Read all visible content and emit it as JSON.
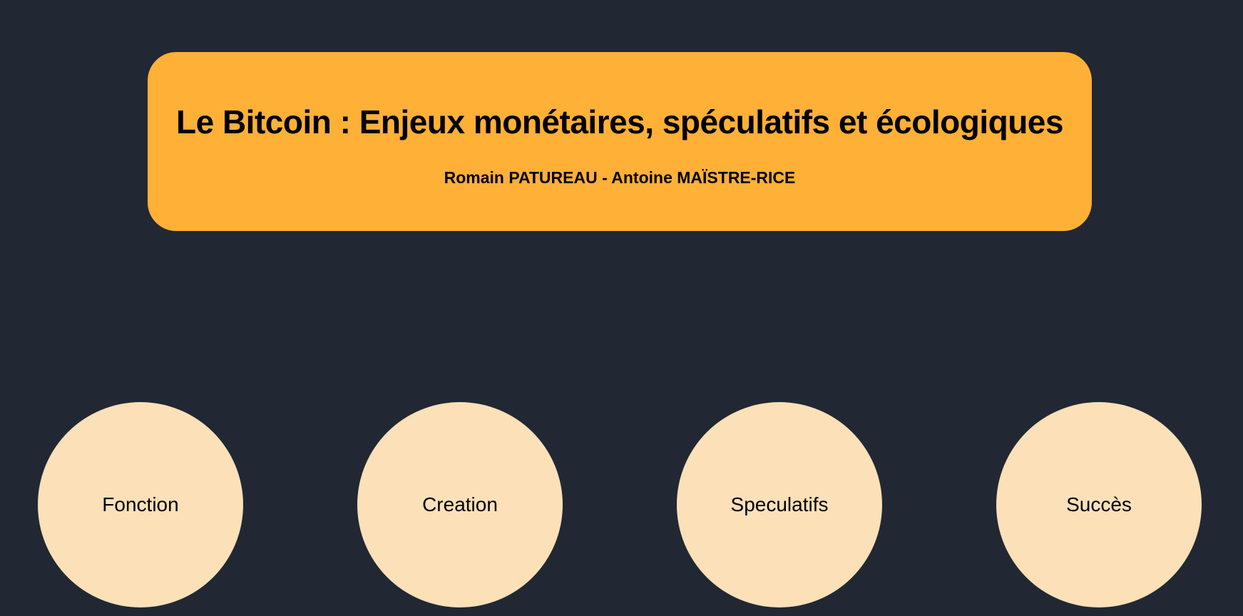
{
  "header": {
    "title": "Le Bitcoin : Enjeux monétaires, spéculatifs et écologiques",
    "authors": "Romain PATUREAU - Antoine MAÏSTRE-RICE"
  },
  "topics": [
    {
      "label": "Fonction"
    },
    {
      "label": "Creation"
    },
    {
      "label": "Speculatifs"
    },
    {
      "label": "Succès"
    }
  ],
  "colors": {
    "background": "#212833",
    "header_card": "#ffb037",
    "topic_circle": "#fbe0b8",
    "text": "#000000"
  }
}
